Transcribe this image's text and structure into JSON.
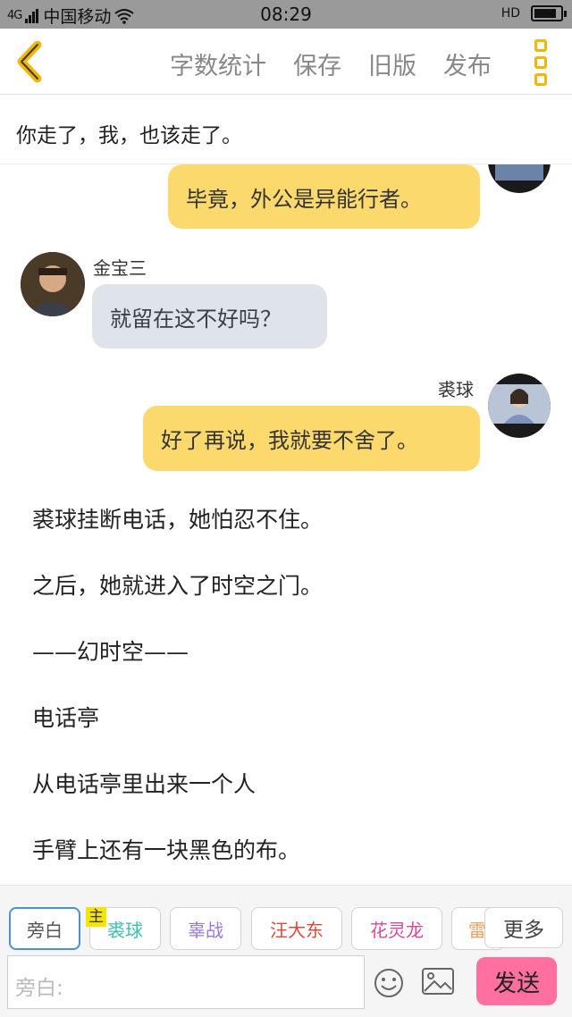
{
  "status_bar": {
    "network": "4G",
    "carrier": "中国移动",
    "time": "08:29",
    "hd": "HD",
    "battery_level": 0.85
  },
  "toolbar": {
    "word_count": "字数统计",
    "save": "保存",
    "old_version": "旧版",
    "publish": "发布"
  },
  "chapter_title": "你走了，我，也该走了。",
  "messages": [
    {
      "side": "right",
      "text": "毕竟，外公是异能行者。"
    },
    {
      "side": "left",
      "name": "金宝三",
      "text": "就留在这不好吗？"
    },
    {
      "side": "right",
      "name": "裘球",
      "text": "好了再说，我就要不舍了。"
    }
  ],
  "narration": [
    "裘球挂断电话，她怕忍不住。",
    "之后，她就进入了时空之门。",
    "——幻时空——",
    "电话亭",
    "从电话亭里出来一个人",
    "手臂上还有一块黑色的布。"
  ],
  "characters": {
    "narrator": "旁白",
    "main_tag": "主",
    "list": [
      {
        "label": "裘球",
        "color": "#3cbfae"
      },
      {
        "label": "辜战",
        "color": "#9a7ad8"
      },
      {
        "label": "汪大东",
        "color": "#e0473b"
      },
      {
        "label": "花灵龙",
        "color": "#d8479a"
      },
      {
        "label": "雷",
        "color": "#f0a060"
      }
    ],
    "more": "更多"
  },
  "input": {
    "placeholder": "旁白:",
    "send": "发送"
  },
  "colors": {
    "accent": "#f2b705",
    "bubble_right": "#fcd96c",
    "bubble_left": "#dfe4ea",
    "send": "#ff6f9f"
  }
}
